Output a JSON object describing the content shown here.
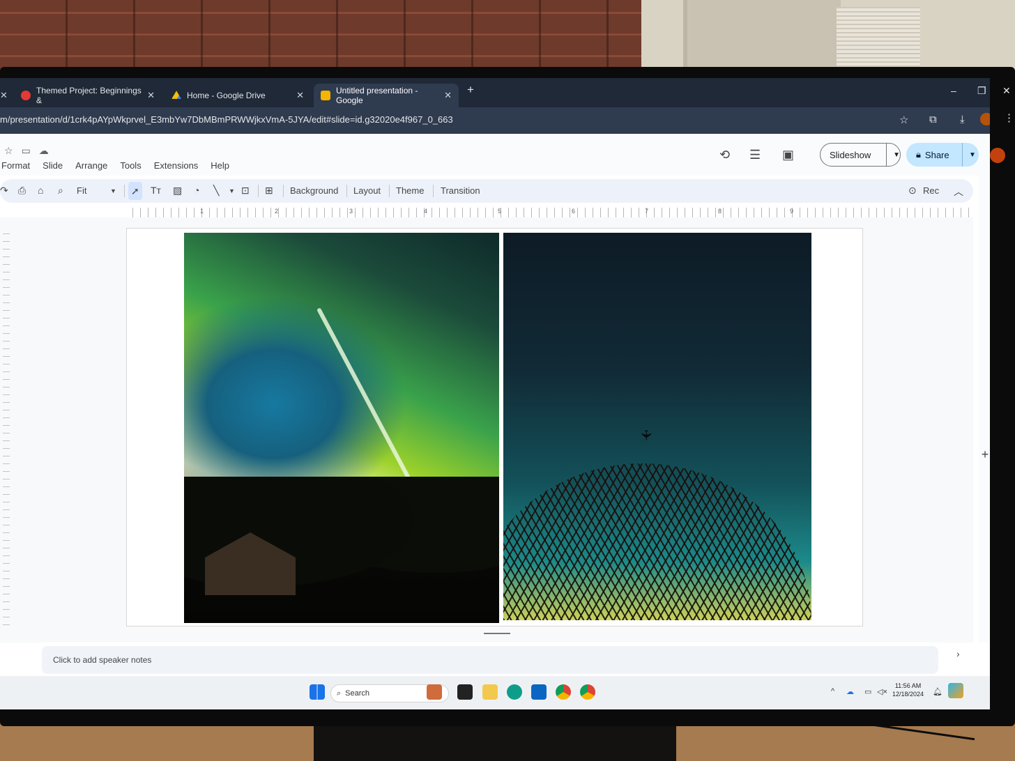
{
  "browser": {
    "tabs": [
      {
        "title": "Themed Project: Beginnings &",
        "favicon_color": "#e53935",
        "active": false
      },
      {
        "title": "Home - Google Drive",
        "favicon_color": "#1e8e3e",
        "active": false
      },
      {
        "title": "Untitled presentation - Google",
        "favicon_color": "#f4b400",
        "active": true
      }
    ],
    "new_tab": "+",
    "window_controls": [
      "–",
      "❐",
      "✕"
    ],
    "url": "m/presentation/d/1crk4pAYpWkprvel_E3mbYw7DbMBmPRWWjkxVmA-5JYA/edit#slide=id.g32020e4f967_0_663"
  },
  "slides_app": {
    "menu": [
      "Format",
      "Slide",
      "Arrange",
      "Tools",
      "Extensions",
      "Help"
    ],
    "slideshow_label": "Slideshow",
    "share_label": "Share",
    "toolbar": {
      "zoom": "Fit",
      "background": "Background",
      "layout": "Layout",
      "theme": "Theme",
      "transition": "Transition",
      "rec": "Rec"
    },
    "ruler_numbers": [
      "1",
      "2",
      "3",
      "4",
      "5",
      "6",
      "7",
      "8",
      "9"
    ],
    "speaker_notes_placeholder": "Click to add speaker notes",
    "accent_color": "#c2e7ff"
  },
  "taskbar": {
    "search_placeholder": "Search",
    "time": "11:56 AM",
    "date": "12/18/2024"
  }
}
